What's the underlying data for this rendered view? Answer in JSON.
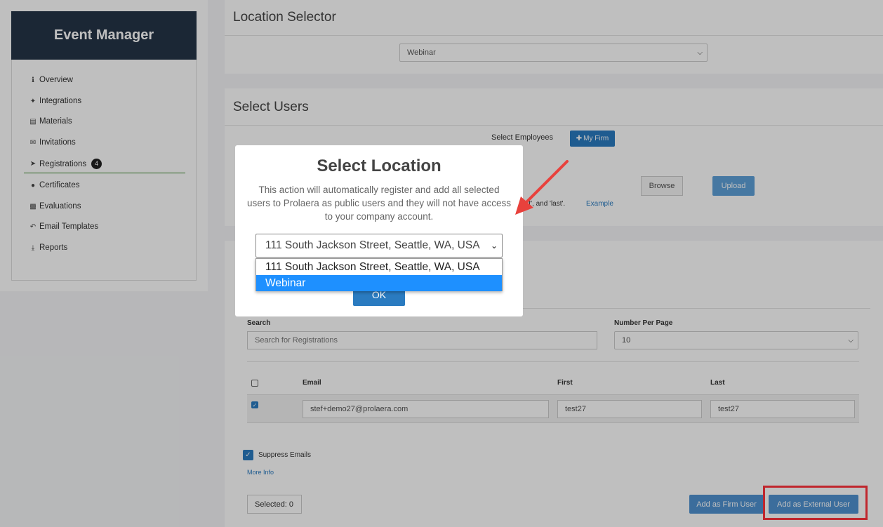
{
  "sidebar": {
    "title": "Event Manager",
    "items": [
      {
        "label": "Overview",
        "icon": "info-icon"
      },
      {
        "label": "Integrations",
        "icon": "puzzle-icon"
      },
      {
        "label": "Materials",
        "icon": "document-icon"
      },
      {
        "label": "Invitations",
        "icon": "envelope-icon"
      },
      {
        "label": "Registrations",
        "icon": "paper-plane-icon",
        "badge": "4"
      },
      {
        "label": "Certificates",
        "icon": "certificate-icon"
      },
      {
        "label": "Evaluations",
        "icon": "bar-chart-icon"
      },
      {
        "label": "Email Templates",
        "icon": "reply-icon"
      },
      {
        "label": "Reports",
        "icon": "download-icon"
      }
    ]
  },
  "location_selector": {
    "title": "Location Selector",
    "selected": "Webinar"
  },
  "select_users": {
    "title": "Select Users",
    "employees_label": "Select Employees",
    "my_firm_button": "My Firm",
    "browse_button": "Browse",
    "upload_button": "Upload",
    "upload_hint": "first', and 'last'.",
    "example_link": "Example"
  },
  "registrations": {
    "search_label": "Search",
    "search_placeholder": "Search for Registrations",
    "per_page_label": "Number Per Page",
    "per_page_value": "10",
    "columns": [
      "Email",
      "First",
      "Last"
    ],
    "rows": [
      {
        "email": "stef+demo27@prolaera.com",
        "first": "test27",
        "last": "test27",
        "checked": true
      }
    ],
    "suppress_label": "Suppress Emails",
    "more_info": "More Info",
    "selected_count": "Selected: 0",
    "add_firm_user": "Add as Firm User",
    "add_external_user": "Add as External User"
  },
  "modal": {
    "title": "Select Location",
    "description": "This action will automatically register and add all selected users to Prolaera as public users and they will not have access to your company account.",
    "selected": "111 South Jackson Street, Seattle, WA, USA",
    "options": [
      "111 South Jackson Street, Seattle, WA, USA",
      "Webinar"
    ],
    "highlighted_option": "Webinar",
    "ok_button": "OK"
  },
  "colors": {
    "sidebar_header": "#243447",
    "primary_blue": "#2a7bc0",
    "highlight_box": "#c0262d",
    "annotation_arrow": "#e8413c"
  }
}
